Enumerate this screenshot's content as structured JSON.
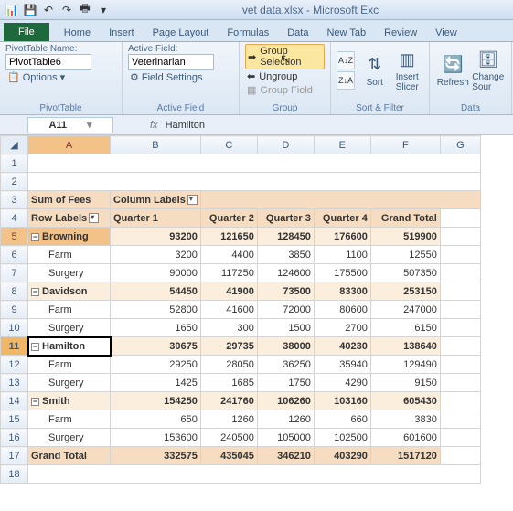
{
  "window": {
    "title": "vet data.xlsx - Microsoft Exc"
  },
  "tabs": {
    "file": "File",
    "home": "Home",
    "insert": "Insert",
    "page_layout": "Page Layout",
    "formulas": "Formulas",
    "data": "Data",
    "new_tab": "New Tab",
    "review": "Review",
    "view": "View"
  },
  "ribbon": {
    "pivot": {
      "name_label": "PivotTable Name:",
      "name_value": "PivotTable6",
      "options": "Options",
      "group": "PivotTable"
    },
    "active": {
      "field_label": "Active Field:",
      "field_value": "Veterinarian",
      "settings": "Field Settings",
      "group": "Active Field"
    },
    "grouping": {
      "selection": "Group Selection",
      "ungroup": "Ungroup",
      "field": "Group Field",
      "group": "Group"
    },
    "sort": {
      "sort": "Sort",
      "slicer": "Insert\nSlicer",
      "group": "Sort & Filter"
    },
    "data": {
      "refresh": "Refresh",
      "change": "Change\nSour",
      "group": "Data"
    }
  },
  "namebox": {
    "ref": "A11",
    "fx": "fx",
    "value": "Hamilton"
  },
  "cols": [
    "A",
    "B",
    "C",
    "D",
    "E",
    "F",
    "G"
  ],
  "pivot": {
    "sum_label": "Sum of Fees",
    "col_label": "Column Labels",
    "row_label": "Row Labels",
    "col_headers": [
      "Quarter 1",
      "Quarter 2",
      "Quarter 3",
      "Quarter 4",
      "Grand Total"
    ],
    "rows": [
      {
        "r": 5,
        "type": "group",
        "label": "Browning",
        "sel": true,
        "vals": [
          93200,
          121650,
          128450,
          176600,
          519900
        ]
      },
      {
        "r": 6,
        "type": "item",
        "label": "Farm",
        "vals": [
          3200,
          4400,
          3850,
          1100,
          12550
        ]
      },
      {
        "r": 7,
        "type": "item",
        "label": "Surgery",
        "vals": [
          90000,
          117250,
          124600,
          175500,
          507350
        ]
      },
      {
        "r": 8,
        "type": "group",
        "label": "Davidson",
        "vals": [
          54450,
          41900,
          73500,
          83300,
          253150
        ]
      },
      {
        "r": 9,
        "type": "item",
        "label": "Farm",
        "vals": [
          52800,
          41600,
          72000,
          80600,
          247000
        ]
      },
      {
        "r": 10,
        "type": "item",
        "label": "Surgery",
        "vals": [
          1650,
          300,
          1500,
          2700,
          6150
        ]
      },
      {
        "r": 11,
        "type": "group",
        "label": "Hamilton",
        "active": true,
        "vals": [
          30675,
          29735,
          38000,
          40230,
          138640
        ]
      },
      {
        "r": 12,
        "type": "item",
        "label": "Farm",
        "vals": [
          29250,
          28050,
          36250,
          35940,
          129490
        ]
      },
      {
        "r": 13,
        "type": "item",
        "label": "Surgery",
        "vals": [
          1425,
          1685,
          1750,
          4290,
          9150
        ]
      },
      {
        "r": 14,
        "type": "group",
        "label": "Smith",
        "vals": [
          154250,
          241760,
          106260,
          103160,
          605430
        ]
      },
      {
        "r": 15,
        "type": "item",
        "label": "Farm",
        "vals": [
          650,
          1260,
          1260,
          660,
          3830
        ]
      },
      {
        "r": 16,
        "type": "item",
        "label": "Surgery",
        "vals": [
          153600,
          240500,
          105000,
          102500,
          601600
        ]
      },
      {
        "r": 17,
        "type": "total",
        "label": "Grand Total",
        "vals": [
          332575,
          435045,
          346210,
          403290,
          1517120
        ]
      }
    ]
  },
  "chart_data": {
    "type": "table",
    "title": "Sum of Fees",
    "columns": [
      "Quarter 1",
      "Quarter 2",
      "Quarter 3",
      "Quarter 4",
      "Grand Total"
    ],
    "rows": [
      {
        "label": "Browning",
        "values": [
          93200,
          121650,
          128450,
          176600,
          519900
        ],
        "children": [
          {
            "label": "Farm",
            "values": [
              3200,
              4400,
              3850,
              1100,
              12550
            ]
          },
          {
            "label": "Surgery",
            "values": [
              90000,
              117250,
              124600,
              175500,
              507350
            ]
          }
        ]
      },
      {
        "label": "Davidson",
        "values": [
          54450,
          41900,
          73500,
          83300,
          253150
        ],
        "children": [
          {
            "label": "Farm",
            "values": [
              52800,
              41600,
              72000,
              80600,
              247000
            ]
          },
          {
            "label": "Surgery",
            "values": [
              1650,
              300,
              1500,
              2700,
              6150
            ]
          }
        ]
      },
      {
        "label": "Hamilton",
        "values": [
          30675,
          29735,
          38000,
          40230,
          138640
        ],
        "children": [
          {
            "label": "Farm",
            "values": [
              29250,
              28050,
              36250,
              35940,
              129490
            ]
          },
          {
            "label": "Surgery",
            "values": [
              1425,
              1685,
              1750,
              4290,
              9150
            ]
          }
        ]
      },
      {
        "label": "Smith",
        "values": [
          154250,
          241760,
          106260,
          103160,
          605430
        ],
        "children": [
          {
            "label": "Farm",
            "values": [
              650,
              1260,
              1260,
              660,
              3830
            ]
          },
          {
            "label": "Surgery",
            "values": [
              153600,
              240500,
              105000,
              102500,
              601600
            ]
          }
        ]
      },
      {
        "label": "Grand Total",
        "values": [
          332575,
          435045,
          346210,
          403290,
          1517120
        ]
      }
    ]
  }
}
